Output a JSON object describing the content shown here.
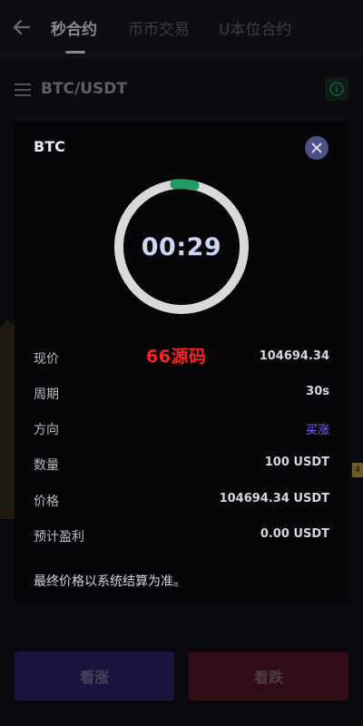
{
  "header": {
    "tabs": [
      {
        "label": "秒合约",
        "active": true
      },
      {
        "label": "币币交易",
        "active": false
      },
      {
        "label": "U本位合约",
        "active": false
      }
    ]
  },
  "pair": {
    "symbol": "BTC/USDT"
  },
  "actions": {
    "buy_up": "看涨",
    "buy_down": "看跌"
  },
  "modal": {
    "title": "BTC",
    "timer": "00:29",
    "watermark": "66源码",
    "rows": [
      {
        "label": "现价",
        "value": "104694.34"
      },
      {
        "label": "周期",
        "value": "30s"
      },
      {
        "label": "方向",
        "value": "买涨"
      },
      {
        "label": "数量",
        "value": "100 USDT"
      },
      {
        "label": "价格",
        "value": "104694.34 USDT"
      },
      {
        "label": "预计盈利",
        "value": "0.00 USDT"
      }
    ],
    "note": "最终价格以系统结算为准。"
  },
  "colors": {
    "accent_purple": "#7d6bff",
    "progress_green": "#1f9b63",
    "up_button": "#2a1f60",
    "down_button": "#4a1421"
  }
}
